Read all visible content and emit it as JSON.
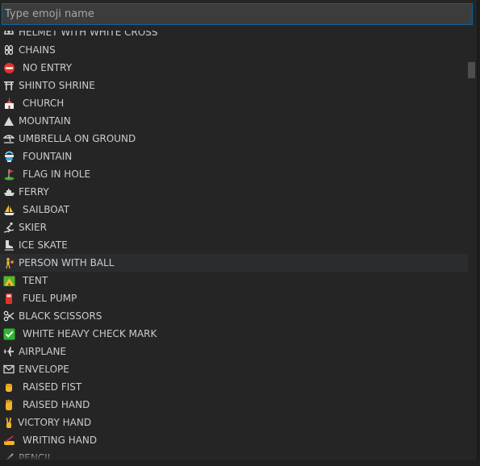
{
  "search": {
    "placeholder": "Type emoji name",
    "value": ""
  },
  "colors": {
    "background": "#252526",
    "input_border": "#0e639c",
    "text": "#cccccc",
    "selected_row": "#2a2d2e"
  },
  "selected_index": 13,
  "items": [
    {
      "label": "HELMET WITH WHITE CROSS",
      "icon": "helmet-icon"
    },
    {
      "label": "CHAINS",
      "icon": "chains-icon"
    },
    {
      "label": "NO ENTRY",
      "icon": "no-entry-icon"
    },
    {
      "label": "SHINTO SHRINE",
      "icon": "shrine-icon"
    },
    {
      "label": "CHURCH",
      "icon": "church-icon"
    },
    {
      "label": "MOUNTAIN",
      "icon": "mountain-icon"
    },
    {
      "label": "UMBRELLA ON GROUND",
      "icon": "umbrella-icon"
    },
    {
      "label": "FOUNTAIN",
      "icon": "fountain-icon"
    },
    {
      "label": "FLAG IN HOLE",
      "icon": "flag-icon"
    },
    {
      "label": "FERRY",
      "icon": "ferry-icon"
    },
    {
      "label": "SAILBOAT",
      "icon": "sailboat-icon"
    },
    {
      "label": "SKIER",
      "icon": "skier-icon"
    },
    {
      "label": "ICE SKATE",
      "icon": "ice-skate-icon"
    },
    {
      "label": "PERSON WITH BALL",
      "icon": "person-ball-icon"
    },
    {
      "label": "TENT",
      "icon": "tent-icon"
    },
    {
      "label": "FUEL PUMP",
      "icon": "fuel-pump-icon"
    },
    {
      "label": "BLACK SCISSORS",
      "icon": "scissors-icon"
    },
    {
      "label": "WHITE HEAVY CHECK MARK",
      "icon": "check-mark-icon"
    },
    {
      "label": "AIRPLANE",
      "icon": "airplane-icon"
    },
    {
      "label": "ENVELOPE",
      "icon": "envelope-icon"
    },
    {
      "label": "RAISED FIST",
      "icon": "fist-icon"
    },
    {
      "label": "RAISED HAND",
      "icon": "hand-icon"
    },
    {
      "label": "VICTORY HAND",
      "icon": "victory-hand-icon"
    },
    {
      "label": "WRITING HAND",
      "icon": "writing-hand-icon"
    },
    {
      "label": "PENCIL",
      "icon": "pencil-icon"
    }
  ]
}
